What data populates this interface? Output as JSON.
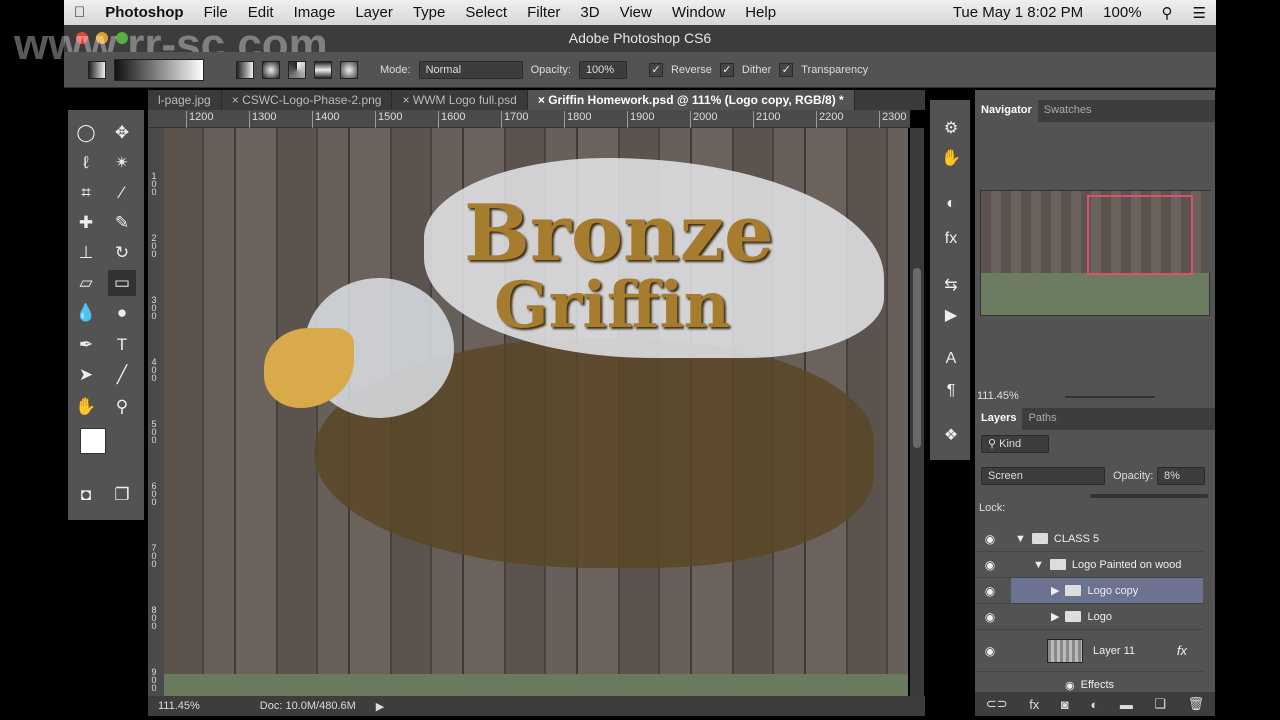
{
  "menubar": {
    "app": "Photoshop",
    "items": [
      "File",
      "Edit",
      "Image",
      "Layer",
      "Type",
      "Select",
      "Filter",
      "3D",
      "View",
      "Window",
      "Help"
    ],
    "clock": "Tue May 1  8:02 PM",
    "battery": "100%"
  },
  "window": {
    "title": "Adobe Photoshop CS6"
  },
  "options": {
    "mode_label": "Mode:",
    "mode": "Normal",
    "opacity_label": "Opacity:",
    "opacity": "100%",
    "reverse": "Reverse",
    "dither": "Dither",
    "transparency": "Transparency"
  },
  "tabs": [
    {
      "label": "l-page.jpg"
    },
    {
      "label": "CSWC-Logo-Phase-2.png"
    },
    {
      "label": "WWM Logo full.psd"
    },
    {
      "label": "Griffin Homework.psd @ 111% (Logo copy, RGB/8) *"
    }
  ],
  "ruler": {
    "h": [
      "1200",
      "1300",
      "1400",
      "1500",
      "1600",
      "1700",
      "1800",
      "1900",
      "2000",
      "2100",
      "2200",
      "2300"
    ],
    "v": [
      "100",
      "200",
      "300",
      "400",
      "500",
      "600",
      "700",
      "800",
      "900"
    ]
  },
  "canvas": {
    "logo_line1": "Bronze",
    "logo_line2": "Griffin"
  },
  "status": {
    "zoom": "111.45%",
    "doc": "Doc: 10.0M/480.6M"
  },
  "navigator": {
    "tabs": [
      "Navigator",
      "Swatches"
    ],
    "zoom": "111.45%"
  },
  "layers": {
    "tabs": [
      "Layers",
      "Paths"
    ],
    "filter": "Kind",
    "blend": "Screen",
    "opacity_label": "Opacity:",
    "opacity": "8%",
    "lock_label": "Lock:",
    "rows": [
      {
        "name": "CLASS 5",
        "type": "group-open",
        "indent": 0
      },
      {
        "name": "Logo Painted on wood",
        "type": "group-open",
        "indent": 1
      },
      {
        "name": "Logo copy",
        "type": "group",
        "indent": 2,
        "selected": true
      },
      {
        "name": "Logo",
        "type": "group",
        "indent": 2
      },
      {
        "name": "Layer 11",
        "type": "layer",
        "fx": "fx"
      },
      {
        "name": "Effects",
        "type": "effects"
      }
    ]
  },
  "watermark": "www.rr-sc.com",
  "colors": {
    "accent": "#e0506a",
    "selected_layer": "#6b7390"
  }
}
